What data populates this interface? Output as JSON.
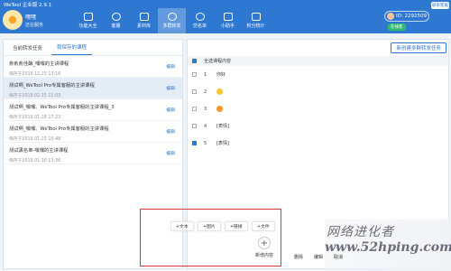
{
  "titlebar": {
    "title": "WeTool 企业版 2.9.1",
    "min": "—",
    "close": "✕"
  },
  "user": {
    "name": "嘿嘿",
    "status": "还在服务"
  },
  "nav": [
    {
      "label": "功能大全",
      "icon": "grid-icon"
    },
    {
      "label": "客服",
      "icon": "headset-icon"
    },
    {
      "label": "素材库",
      "icon": "folder-icon"
    },
    {
      "label": "多群转发",
      "icon": "group-forward-icon",
      "active": true
    },
    {
      "label": "仿名单",
      "icon": "person-list-icon"
    },
    {
      "label": "小助手",
      "icon": "robot-icon"
    },
    {
      "label": "积分统计",
      "icon": "chart-icon"
    }
  ],
  "account": {
    "id": "ID: 2292509",
    "online": "在线客",
    "contact": "联系客服"
  },
  "left": {
    "tabs": [
      {
        "label": "当前转发任务"
      },
      {
        "label": "我保存的课程",
        "active": true
      }
    ],
    "courses": [
      {
        "name": "俞俞俞佳酿_嘿嘿的主讲课程",
        "date": "保存于2019.12.23 13:16",
        "edit": "编辑"
      },
      {
        "name": "测试啊_WeTool Pro专属客服的主讲课程",
        "date": "保存于2019.02.15 11:03",
        "edit": "编辑",
        "selected": true
      },
      {
        "name": "测试啊_嘿嘿、WeTool Pro专属客服的主讲课程_3",
        "date": "保存于2019.01.28 17:23",
        "edit": "编辑"
      },
      {
        "name": "测试啊_嘿嘿、WeTool Pro专属客服的主讲课程",
        "date": "保存于2019.01.23 10:48",
        "edit": "编辑"
      },
      {
        "name": "测试黑名单-嘿嘿的主讲课程",
        "date": "保存于2019.01.16 13:36",
        "edit": "编辑"
      }
    ]
  },
  "right": {
    "new_button": "新创建多群转发任务",
    "header_label": "全选课程内容",
    "rows": [
      {
        "index": "1",
        "text": "你好",
        "checked": false
      },
      {
        "index": "2",
        "text": "",
        "emoji": "smile-emoji",
        "checked": false
      },
      {
        "index": "3",
        "text": "",
        "emoji": "laugh-emoji",
        "checked": false
      },
      {
        "index": "4",
        "text": "[表情]",
        "checked": false
      },
      {
        "index": "5",
        "text": "[表情]",
        "checked": true
      }
    ]
  },
  "composer": {
    "pills": [
      "+文本",
      "+图片",
      "+链接",
      "+文件"
    ],
    "add_label": "新增内容",
    "plus": "+",
    "actions": [
      "删除",
      "编辑",
      "取消"
    ]
  },
  "watermark": {
    "line1": "网络进化者",
    "line2": "www.52hping.com"
  }
}
